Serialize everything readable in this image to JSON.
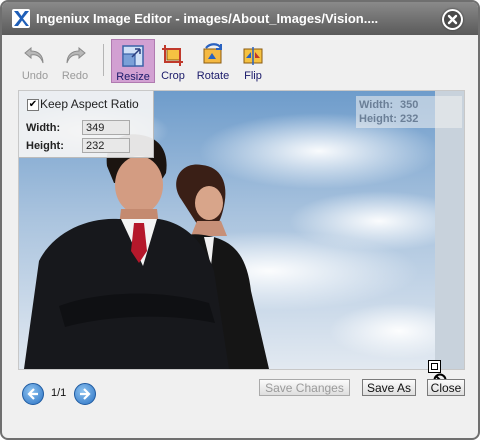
{
  "window": {
    "title": "Ingeniux Image Editor - images/About_Images/Vision....",
    "logo_icon": "ingeniux-x-logo-icon",
    "close_icon": "close-x-icon"
  },
  "toolbar": {
    "undo_label": "Undo",
    "redo_label": "Redo",
    "resize_label": "Resize",
    "crop_label": "Crop",
    "rotate_label": "Rotate",
    "flip_label": "Flip",
    "active_tool": "Resize",
    "active_color": "#d2a0d2"
  },
  "resize_panel": {
    "keep_aspect_label": "Keep Aspect Ratio",
    "keep_aspect_checked": true,
    "width_label": "Width:",
    "width_value": "349",
    "height_label": "Height:",
    "height_value": "232"
  },
  "original_size": {
    "width_label": "Width:",
    "width_value": "350",
    "height_label": "Height:",
    "height_value": "232"
  },
  "pager": {
    "text": "1/1",
    "prev_icon": "arrow-left-icon",
    "next_icon": "arrow-right-icon"
  },
  "footer": {
    "save_changes_label": "Save Changes",
    "save_as_label": "Save As",
    "close_label": "Close"
  }
}
